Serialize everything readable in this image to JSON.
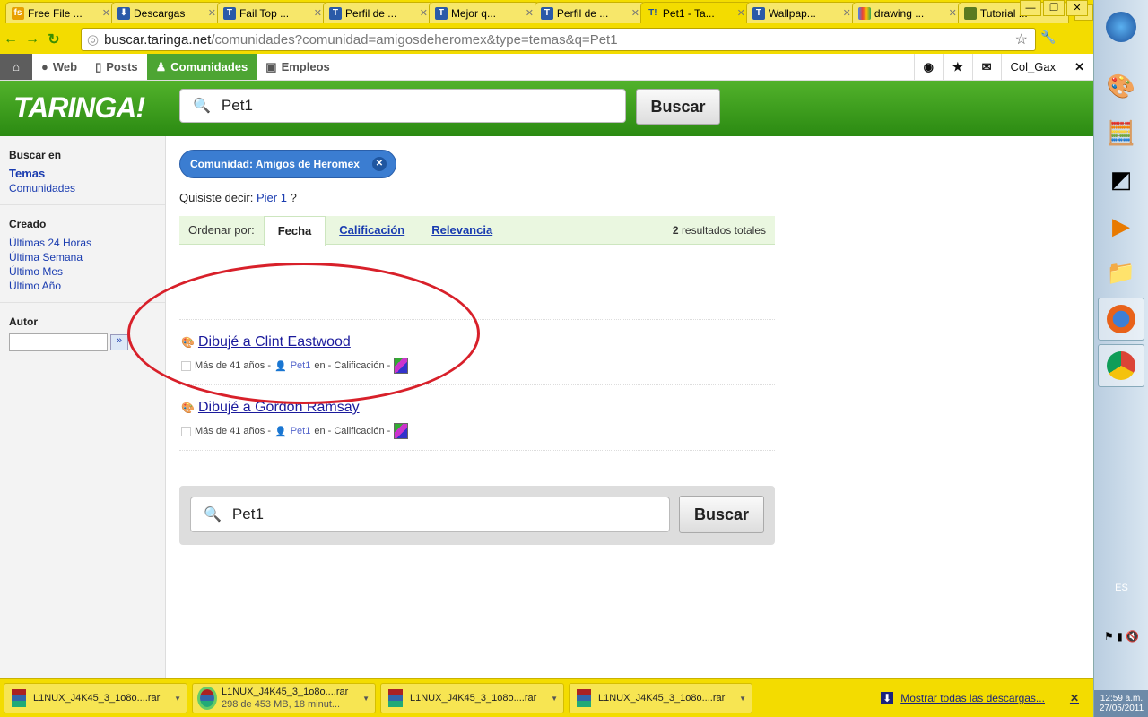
{
  "browser": {
    "tabs": [
      {
        "icon": "fs-icon",
        "label": "Free File ..."
      },
      {
        "icon": "download-icon",
        "label": "Descargas"
      },
      {
        "icon": "taringa-icon",
        "label": "Fail Top ..."
      },
      {
        "icon": "taringa-icon",
        "label": "Perfil de ..."
      },
      {
        "icon": "taringa-icon",
        "label": "Mejor q..."
      },
      {
        "icon": "taringa-icon",
        "label": "Perfil de ..."
      },
      {
        "icon": "taringa-icon",
        "label": "Pet1 - Ta...",
        "active": true
      },
      {
        "icon": "taringa-icon",
        "label": "Wallpap..."
      },
      {
        "icon": "google-icon",
        "label": "drawing ..."
      },
      {
        "icon": "tutorial-icon",
        "label": "Tutorial ..."
      }
    ],
    "url_host": "buscar.taringa.net",
    "url_path": "/comunidades?comunidad=amigosdeheromex&type=temas&q=Pet1"
  },
  "topnav": {
    "web": "Web",
    "posts": "Posts",
    "comunidades": "Comunidades",
    "empleos": "Empleos",
    "user": "Col_Gax"
  },
  "header": {
    "logo": "TARINGA!",
    "search_value": "Pet1",
    "search_button": "Buscar"
  },
  "sidebar": {
    "buscar_en": "Buscar en",
    "temas": "Temas",
    "comunidades": "Comunidades",
    "creado": "Creado",
    "periods": [
      "Últimas 24 Horas",
      "Última Semana",
      "Último Mes",
      "Último Año"
    ],
    "autor": "Autor",
    "autor_go": "»"
  },
  "main": {
    "chip": "Comunidad: Amigos de Heromex",
    "quisiste_prefix": "Quisiste decir:",
    "quisiste_link": "Pier 1",
    "quisiste_suffix": "?",
    "ordenar": "Ordenar por:",
    "sort_tabs": [
      "Fecha",
      "Calificación",
      "Relevancia"
    ],
    "total_count": "2",
    "total_label": "resultados totales",
    "results": [
      {
        "title": "Dibujé a Clint Eastwood",
        "age": "Más de 41 años -",
        "user": "Pet1",
        "rest": "en - Calificación -"
      },
      {
        "title": "Dibujé a Gordon Ramsay",
        "age": "Más de 41 años -",
        "user": "Pet1",
        "rest": "en - Calificación -"
      }
    ],
    "bottom_search_value": "Pet1",
    "bottom_search_button": "Buscar"
  },
  "downloads": {
    "items": [
      {
        "name": "L1NUX_J4K45_3_1o8o....rar"
      },
      {
        "name": "L1NUX_J4K45_3_1o8o....rar",
        "status": "298 de 453 MB, 18 minut..."
      },
      {
        "name": "L1NUX_J4K45_3_1o8o....rar"
      },
      {
        "name": "L1NUX_J4K45_3_1o8o....rar"
      }
    ],
    "show_all": "Mostrar todas las descargas..."
  },
  "taskbar": {
    "lang": "ES",
    "time": "12:59 a.m.",
    "date": "27/05/2011"
  },
  "colors": {
    "taringa_green": "#3f9e1f",
    "chrome_yellow": "#f3dc00",
    "link": "#1a3cb0",
    "annotation_red": "#d8202a"
  }
}
